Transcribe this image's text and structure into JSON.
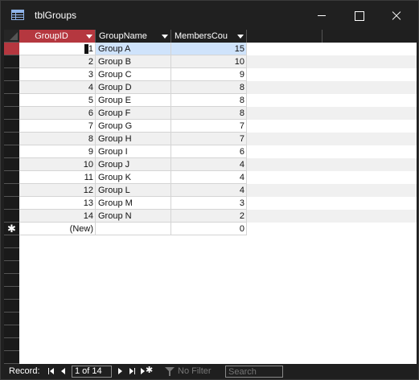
{
  "window": {
    "title": "tblGroups"
  },
  "columns": [
    {
      "name": "GroupID"
    },
    {
      "name": "GroupName"
    },
    {
      "name": "MembersCou"
    }
  ],
  "rows": [
    {
      "id": "1",
      "name": "Group A",
      "count": "15"
    },
    {
      "id": "2",
      "name": "Group B",
      "count": "10"
    },
    {
      "id": "3",
      "name": "Group C",
      "count": "9"
    },
    {
      "id": "4",
      "name": "Group D",
      "count": "8"
    },
    {
      "id": "5",
      "name": "Group E",
      "count": "8"
    },
    {
      "id": "6",
      "name": "Group F",
      "count": "8"
    },
    {
      "id": "7",
      "name": "Group G",
      "count": "7"
    },
    {
      "id": "8",
      "name": "Group H",
      "count": "7"
    },
    {
      "id": "9",
      "name": "Group I",
      "count": "6"
    },
    {
      "id": "10",
      "name": "Group J",
      "count": "4"
    },
    {
      "id": "11",
      "name": "Group K",
      "count": "4"
    },
    {
      "id": "12",
      "name": "Group L",
      "count": "4"
    },
    {
      "id": "13",
      "name": "Group M",
      "count": "3"
    },
    {
      "id": "14",
      "name": "Group N",
      "count": "2"
    }
  ],
  "new_row": {
    "id": "(New)",
    "name": "",
    "count": "0",
    "marker": "✱"
  },
  "navigation": {
    "record_label": "Record:",
    "position": "1 of 14",
    "filter_label": "No Filter",
    "search_placeholder": "Search"
  },
  "colors": {
    "selected_header": "#b5373f",
    "current_row_highlight": "#cfe3fb",
    "chrome": "#1f1f1f"
  }
}
